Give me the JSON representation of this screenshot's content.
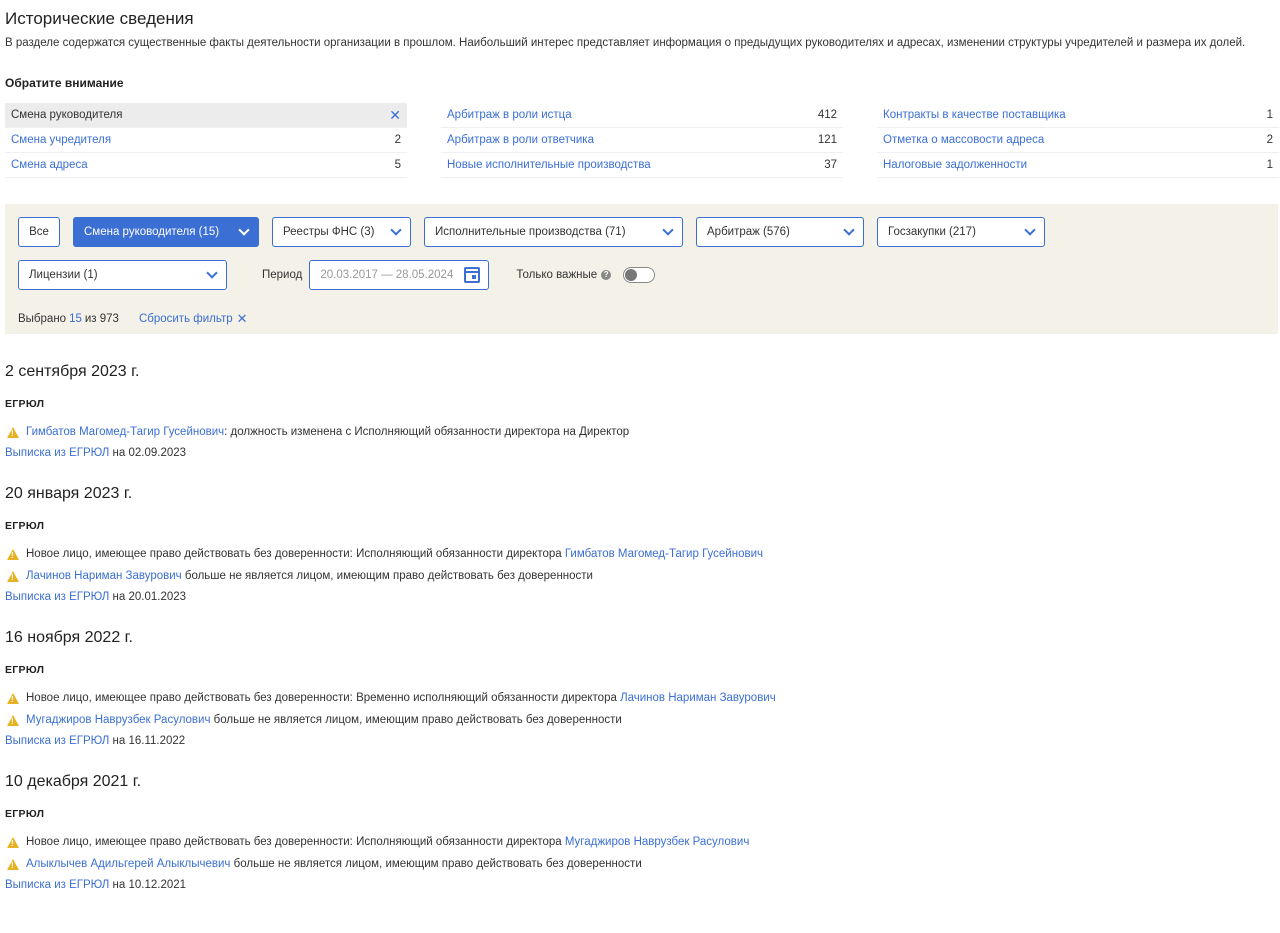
{
  "title": "Исторические сведения",
  "intro": "В разделе содержатся существенные факты деятельности организации в прошлом. Наибольший интерес представляет информация о предыдущих руководителях и адресах, изменении структуры учредителей и размера их долей.",
  "notice_heading": "Обратите внимание",
  "facts": {
    "col1": [
      {
        "label": "Смена руководителя",
        "count": "",
        "active": true
      },
      {
        "label": "Смена учредителя",
        "count": "2"
      },
      {
        "label": "Смена адреса",
        "count": "5"
      }
    ],
    "col2": [
      {
        "label": "Арбитраж в роли истца",
        "count": "412"
      },
      {
        "label": "Арбитраж в роли ответчика",
        "count": "121"
      },
      {
        "label": "Новые исполнительные производства",
        "count": "37"
      }
    ],
    "col3": [
      {
        "label": "Контракты в качестве поставщика",
        "count": "1"
      },
      {
        "label": "Отметка о массовости адреса",
        "count": "2"
      },
      {
        "label": "Налоговые задолженности",
        "count": "1"
      }
    ],
    "close_symbol": "✕"
  },
  "filters": {
    "all": "Все",
    "leader_change": "Смена руководителя (15)",
    "fns": "Реестры ФНС (3)",
    "enforcement": "Исполнительные производства (71)",
    "arbitration": "Арбитраж (576)",
    "procurement": "Госзакупки (217)",
    "licenses": "Лицензии (1)",
    "period_label": "Период",
    "period_placeholder": "20.03.2017 — 28.05.2024",
    "important_label": "Только важные",
    "help_symbol": "?",
    "selected_prefix": "Выбрано",
    "selected_count": "15",
    "selected_suffix": "из 973",
    "reset_label": "Сбросить фильтр",
    "reset_symbol": "✕"
  },
  "events": [
    {
      "date": "2 сентября 2023 г.",
      "source": "ЕГРЮЛ",
      "lines": [
        {
          "before": "",
          "link": "Гимбатов Магомед-Тагир Гусейнович",
          "after": ": должность изменена с Исполняющий обязанности директора на Директор"
        }
      ],
      "extract_link": "Выписка из ЕГРЮЛ",
      "extract_date": " на 02.09.2023"
    },
    {
      "date": "20 января 2023 г.",
      "source": "ЕГРЮЛ",
      "lines": [
        {
          "before": "Новое лицо, имеющее право действовать без доверенности: Исполняющий обязанности директора ",
          "link": "Гимбатов Магомед-Тагир Гусейнович",
          "after": ""
        },
        {
          "before": "",
          "link": "Лачинов Нариман Завурович",
          "after": " больше не является лицом, имеющим право действовать без доверенности"
        }
      ],
      "extract_link": "Выписка из ЕГРЮЛ",
      "extract_date": " на 20.01.2023"
    },
    {
      "date": "16 ноября 2022 г.",
      "source": "ЕГРЮЛ",
      "lines": [
        {
          "before": "Новое лицо, имеющее право действовать без доверенности: Временно исполняющий обязанности директора ",
          "link": "Лачинов Нариман Завурович",
          "after": ""
        },
        {
          "before": "",
          "link": "Мугаджиров Наврузбек Расулович",
          "after": " больше не является лицом, имеющим право действовать без доверенности"
        }
      ],
      "extract_link": "Выписка из ЕГРЮЛ",
      "extract_date": " на 16.11.2022"
    },
    {
      "date": "10 декабря 2021 г.",
      "source": "ЕГРЮЛ",
      "lines": [
        {
          "before": "Новое лицо, имеющее право действовать без доверенности: Исполняющий обязанности директора ",
          "link": "Мугаджиров Наврузбек Расулович",
          "after": ""
        },
        {
          "before": "",
          "link": "Алыклычев Адильгерей Алыклычевич",
          "after": " больше не является лицом, имеющим право действовать без доверенности"
        }
      ],
      "extract_link": "Выписка из ЕГРЮЛ",
      "extract_date": " на 10.12.2021"
    }
  ],
  "colors": {
    "accent": "#3b6fd4",
    "panel": "#f3f1e8",
    "warning": "#e6b224"
  }
}
